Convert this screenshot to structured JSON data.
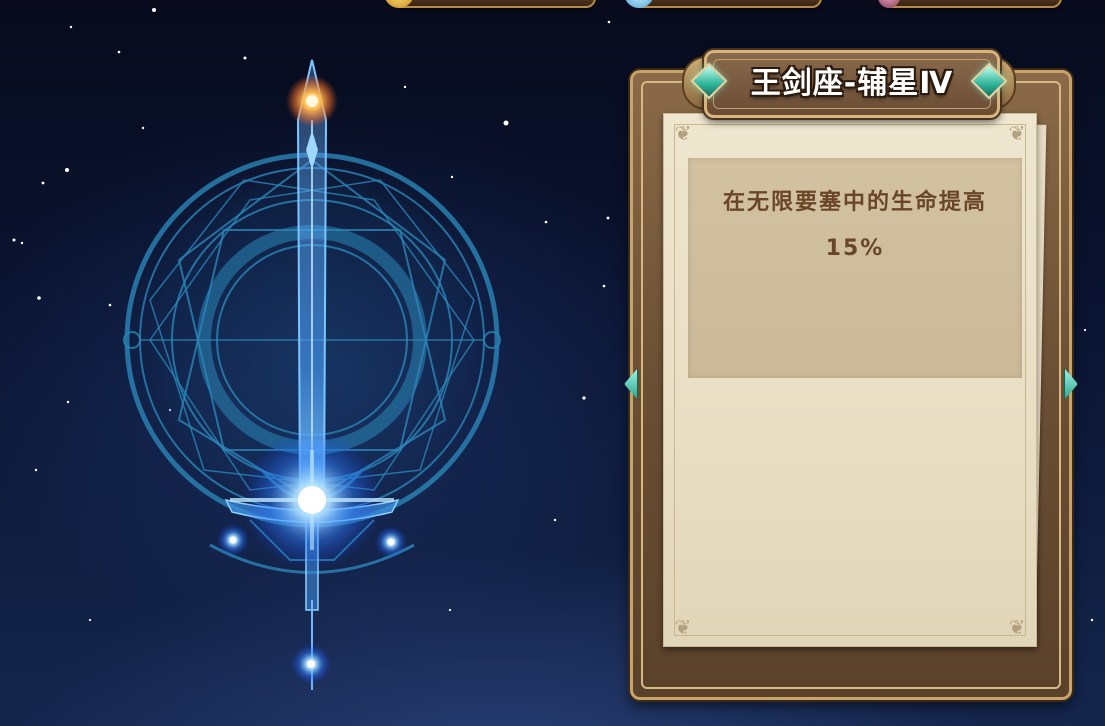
{
  "constellation": {
    "name": "王剑座-辅星Ⅳ"
  },
  "detail": {
    "description_line1": "在无限要塞中的生命提高",
    "description_line2": "15%"
  },
  "colors": {
    "glow": "#4fb6ff",
    "rune": "#1e6f9c",
    "panel_wood": "#6b4f34",
    "paper": "#e8dec4",
    "text_brown": "#6a4628"
  },
  "icons": {
    "top_left_resource": "gold-coin-icon",
    "top_mid_resource": "crystal-icon",
    "top_right_resource": "gem-icon"
  }
}
